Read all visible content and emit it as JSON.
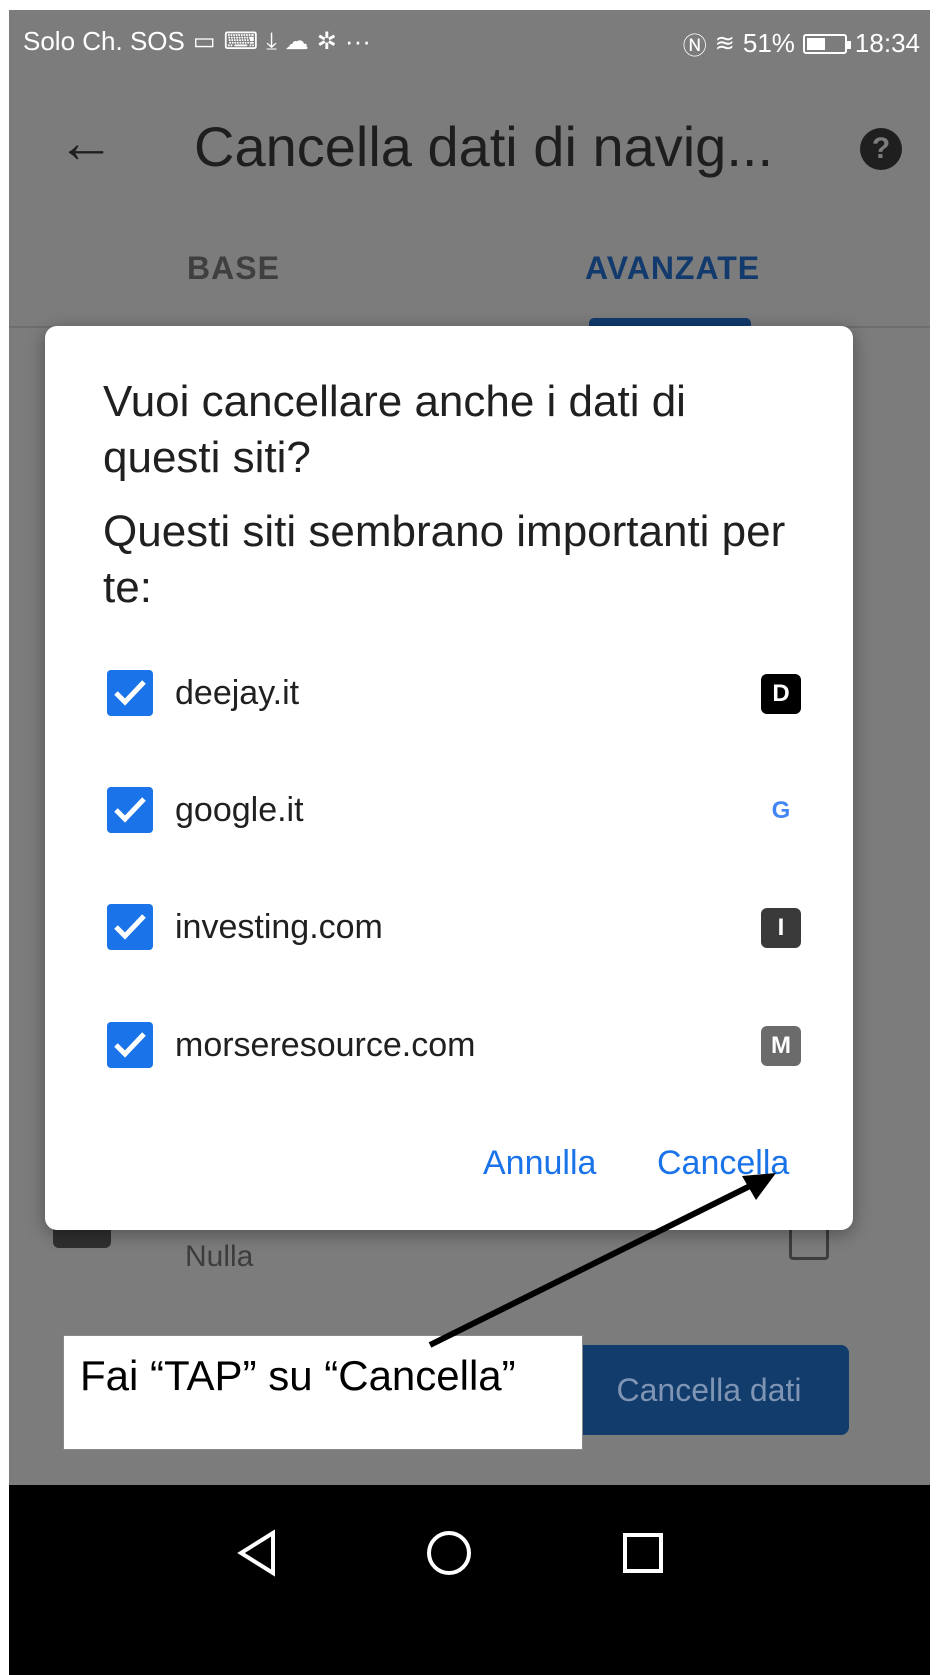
{
  "status_bar": {
    "carrier": "Solo Ch. SOS",
    "left_icons": [
      "sim-icon",
      "laptop-icon",
      "download-icon",
      "cloud-icon",
      "bluetooth-icon"
    ],
    "overflow": "···",
    "battery_percent": "51%",
    "battery_level": 0.51,
    "time": "18:34"
  },
  "toolbar": {
    "back_icon": "arrow-left-icon",
    "title": "Cancella dati di navig...",
    "help_icon": "help-circle-icon"
  },
  "tabs": [
    {
      "label": "BASE",
      "selected": false
    },
    {
      "label": "AVANZATE",
      "selected": true
    }
  ],
  "background": {
    "row_label": "Nulla",
    "clear_button": "Cancella dati"
  },
  "dialog": {
    "title": "Vuoi cancellare anche i dati di questi siti?",
    "subtitle": "Questi siti sembrano importanti per te:",
    "sites": [
      {
        "name": "deejay.it",
        "checked": true,
        "favicon_letter": "D",
        "favicon_color": "#000000"
      },
      {
        "name": "google.it",
        "checked": true,
        "favicon_letter": "G",
        "favicon_color": "#ffffff"
      },
      {
        "name": "investing.com",
        "checked": true,
        "favicon_letter": "I",
        "favicon_color": "#3a3a3a"
      },
      {
        "name": "morseresource.com",
        "checked": true,
        "favicon_letter": "M",
        "favicon_color": "#6b6b6b"
      }
    ],
    "cancel_label": "Annulla",
    "confirm_label": "Cancella"
  },
  "annotation": {
    "text": "Fai “TAP” su “Cancella”"
  },
  "colors": {
    "accent": "#1a73e8",
    "scrim": "#7c7c7c",
    "tab_selected": "#123a6c"
  }
}
